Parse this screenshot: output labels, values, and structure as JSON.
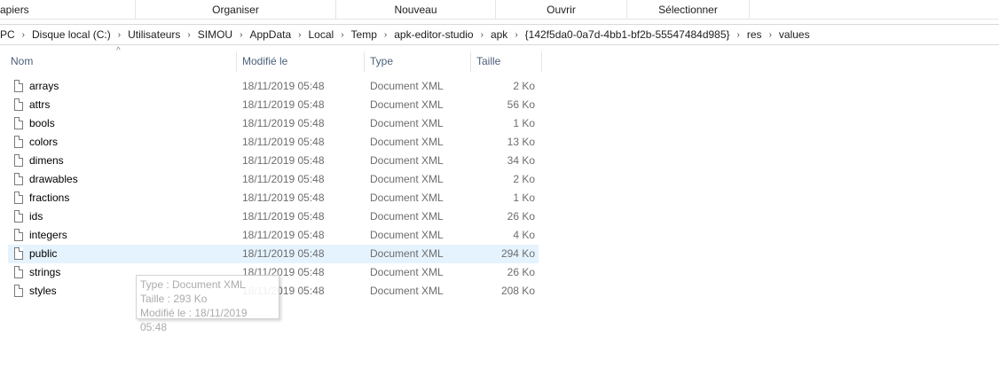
{
  "ribbon": {
    "groups": [
      "apiers",
      "Organiser",
      "Nouveau",
      "Ouvrir",
      "Sélectionner"
    ]
  },
  "address": {
    "crumbs": [
      "PC",
      "Disque local (C:)",
      "Utilisateurs",
      "SIMOU",
      "AppData",
      "Local",
      "Temp",
      "apk-editor-studio",
      "apk",
      "{142f5da0-0a7d-4bb1-bf2b-55547484d985}",
      "res",
      "values"
    ]
  },
  "columns": {
    "name": "Nom",
    "date": "Modifié le",
    "type": "Type",
    "size": "Taille"
  },
  "files": [
    {
      "name": "arrays",
      "date": "18/11/2019 05:48",
      "type": "Document XML",
      "size": "2 Ko"
    },
    {
      "name": "attrs",
      "date": "18/11/2019 05:48",
      "type": "Document XML",
      "size": "56 Ko"
    },
    {
      "name": "bools",
      "date": "18/11/2019 05:48",
      "type": "Document XML",
      "size": "1 Ko"
    },
    {
      "name": "colors",
      "date": "18/11/2019 05:48",
      "type": "Document XML",
      "size": "13 Ko"
    },
    {
      "name": "dimens",
      "date": "18/11/2019 05:48",
      "type": "Document XML",
      "size": "34 Ko"
    },
    {
      "name": "drawables",
      "date": "18/11/2019 05:48",
      "type": "Document XML",
      "size": "2 Ko"
    },
    {
      "name": "fractions",
      "date": "18/11/2019 05:48",
      "type": "Document XML",
      "size": "1 Ko"
    },
    {
      "name": "ids",
      "date": "18/11/2019 05:48",
      "type": "Document XML",
      "size": "26 Ko"
    },
    {
      "name": "integers",
      "date": "18/11/2019 05:48",
      "type": "Document XML",
      "size": "4 Ko"
    },
    {
      "name": "public",
      "date": "18/11/2019 05:48",
      "type": "Document XML",
      "size": "294 Ko"
    },
    {
      "name": "strings",
      "date": "18/11/2019 05:48",
      "type": "Document XML",
      "size": "26 Ko"
    },
    {
      "name": "styles",
      "date": "18/11/2019 05:48",
      "type": "Document XML",
      "size": "208 Ko"
    }
  ],
  "tooltip": {
    "type_line": "Type : Document XML",
    "size_line": "Taille : 293 Ko",
    "date_line": "Modifié le : 18/11/2019 05:48"
  },
  "colors": {
    "hover_row": "#e5f3ff",
    "header_text": "#4c607a"
  },
  "icons": {
    "file": "file-icon",
    "sort": "sort-up-icon",
    "breadcrumb_separator": "chevron-right-icon"
  }
}
